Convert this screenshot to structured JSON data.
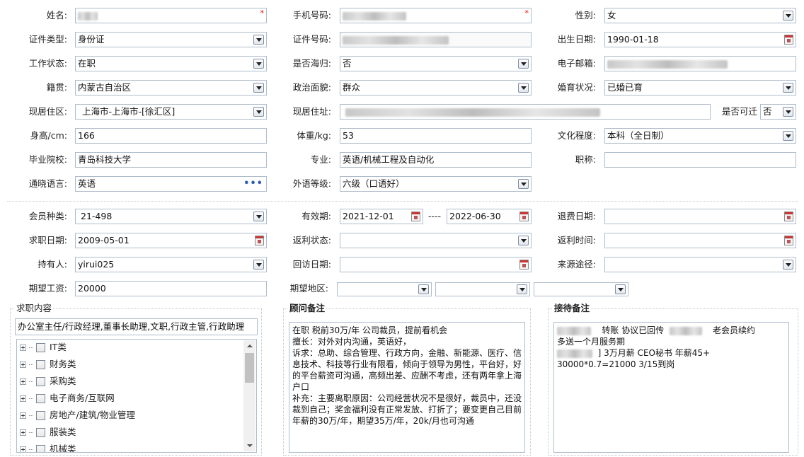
{
  "personal": {
    "name_label": "姓名:",
    "mobile_label": "手机号码:",
    "gender_label": "性别:",
    "gender_value": "女",
    "id_type_label": "证件类型:",
    "id_type_value": "身份证",
    "id_number_label": "证件号码:",
    "birth_label": "出生日期:",
    "birth_value": "1990-01-18",
    "work_status_label": "工作状态:",
    "work_status_value": "在职",
    "returnee_label": "是否海归:",
    "returnee_value": "否",
    "email_label": "电子邮箱:",
    "native_label": "籍贯:",
    "native_value": "内蒙古自治区",
    "political_label": "政治面貌:",
    "political_value": "群众",
    "marital_label": "婚育状况:",
    "marital_value": "已婚已育",
    "residence_label": "现居住区:",
    "residence_value": "上海市-上海市-[徐汇区]",
    "address_label": "现居住址:",
    "relocate_label": "是否可迁",
    "relocate_value": "否",
    "height_label": "身高/cm:",
    "height_value": "166",
    "weight_label": "体重/kg:",
    "weight_value": "53",
    "education_label": "文化程度:",
    "education_value": "本科（全日制）",
    "school_label": "毕业院校:",
    "school_value": "青岛科技大学",
    "major_label": "专业:",
    "major_value": "英语/机械工程及自动化",
    "title_label": "职称:",
    "title_value": "",
    "language_label": "通晓语言:",
    "language_value": "英语",
    "language_more": "•••",
    "foreign_level_label": "外语等级:",
    "foreign_level_value": "六级（口语好）"
  },
  "membership": {
    "member_type_label": "会员种类:",
    "member_type_value": "21-498",
    "valid_label": "有效期:",
    "valid_from": "2021-12-01",
    "valid_sep": "----",
    "valid_to": "2022-06-30",
    "refund_date_label": "退费日期:",
    "refund_date_value": "",
    "job_date_label": "求职日期:",
    "job_date_value": "2009-05-01",
    "rebate_status_label": "返利状态:",
    "rebate_status_value": "",
    "rebate_time_label": "返利时间:",
    "rebate_time_value": "",
    "holder_label": "持有人:",
    "holder_value": "yirui025",
    "revisit_label": "回访日期:",
    "revisit_value": "",
    "source_label": "来源途径:",
    "source_value": "",
    "salary_label": "期望工资:",
    "salary_value": "20000",
    "region_label": "期望地区:"
  },
  "job_content": {
    "title": "求职内容",
    "summary": "办公室主任/行政经理,董事长助理,文职,行政主管,行政助理",
    "categories": [
      "IT类",
      "财务类",
      "采购类",
      "电子商务/互联网",
      "房地产/建筑/物业管理",
      "服装类",
      "机械类"
    ]
  },
  "consultant_note": {
    "title": "顾问备注",
    "text": "在职 税前30万/年 公司裁员，提前看机会\n擅长：对外对内沟通，英语好，\n诉求：总助、综合管理、行政方向，金融、新能源、医疗、信息技术、科技等行业有限看，倾向于领导为男性，平台好，好的平台薪资可沟通，高频出差、应酬不考虑，还有两年拿上海户口\n补充：主要离职原因：公司经营状况不是很好，裁员中，还没裁到自己；奖金福利没有正常发放、打折了；要变更自己目前年薪的30万/年，期望35万/年，20k/月也可沟通"
  },
  "reception_note": {
    "title": "接待备注",
    "line1_a": "转账  协议已回传",
    "line1_b": "老会员续约",
    "line2": "多送一个月服务期",
    "line3": "]  3万月薪  CEO秘书  年薪45+",
    "line4": "30000*0.7=21000  3/15到岗"
  }
}
